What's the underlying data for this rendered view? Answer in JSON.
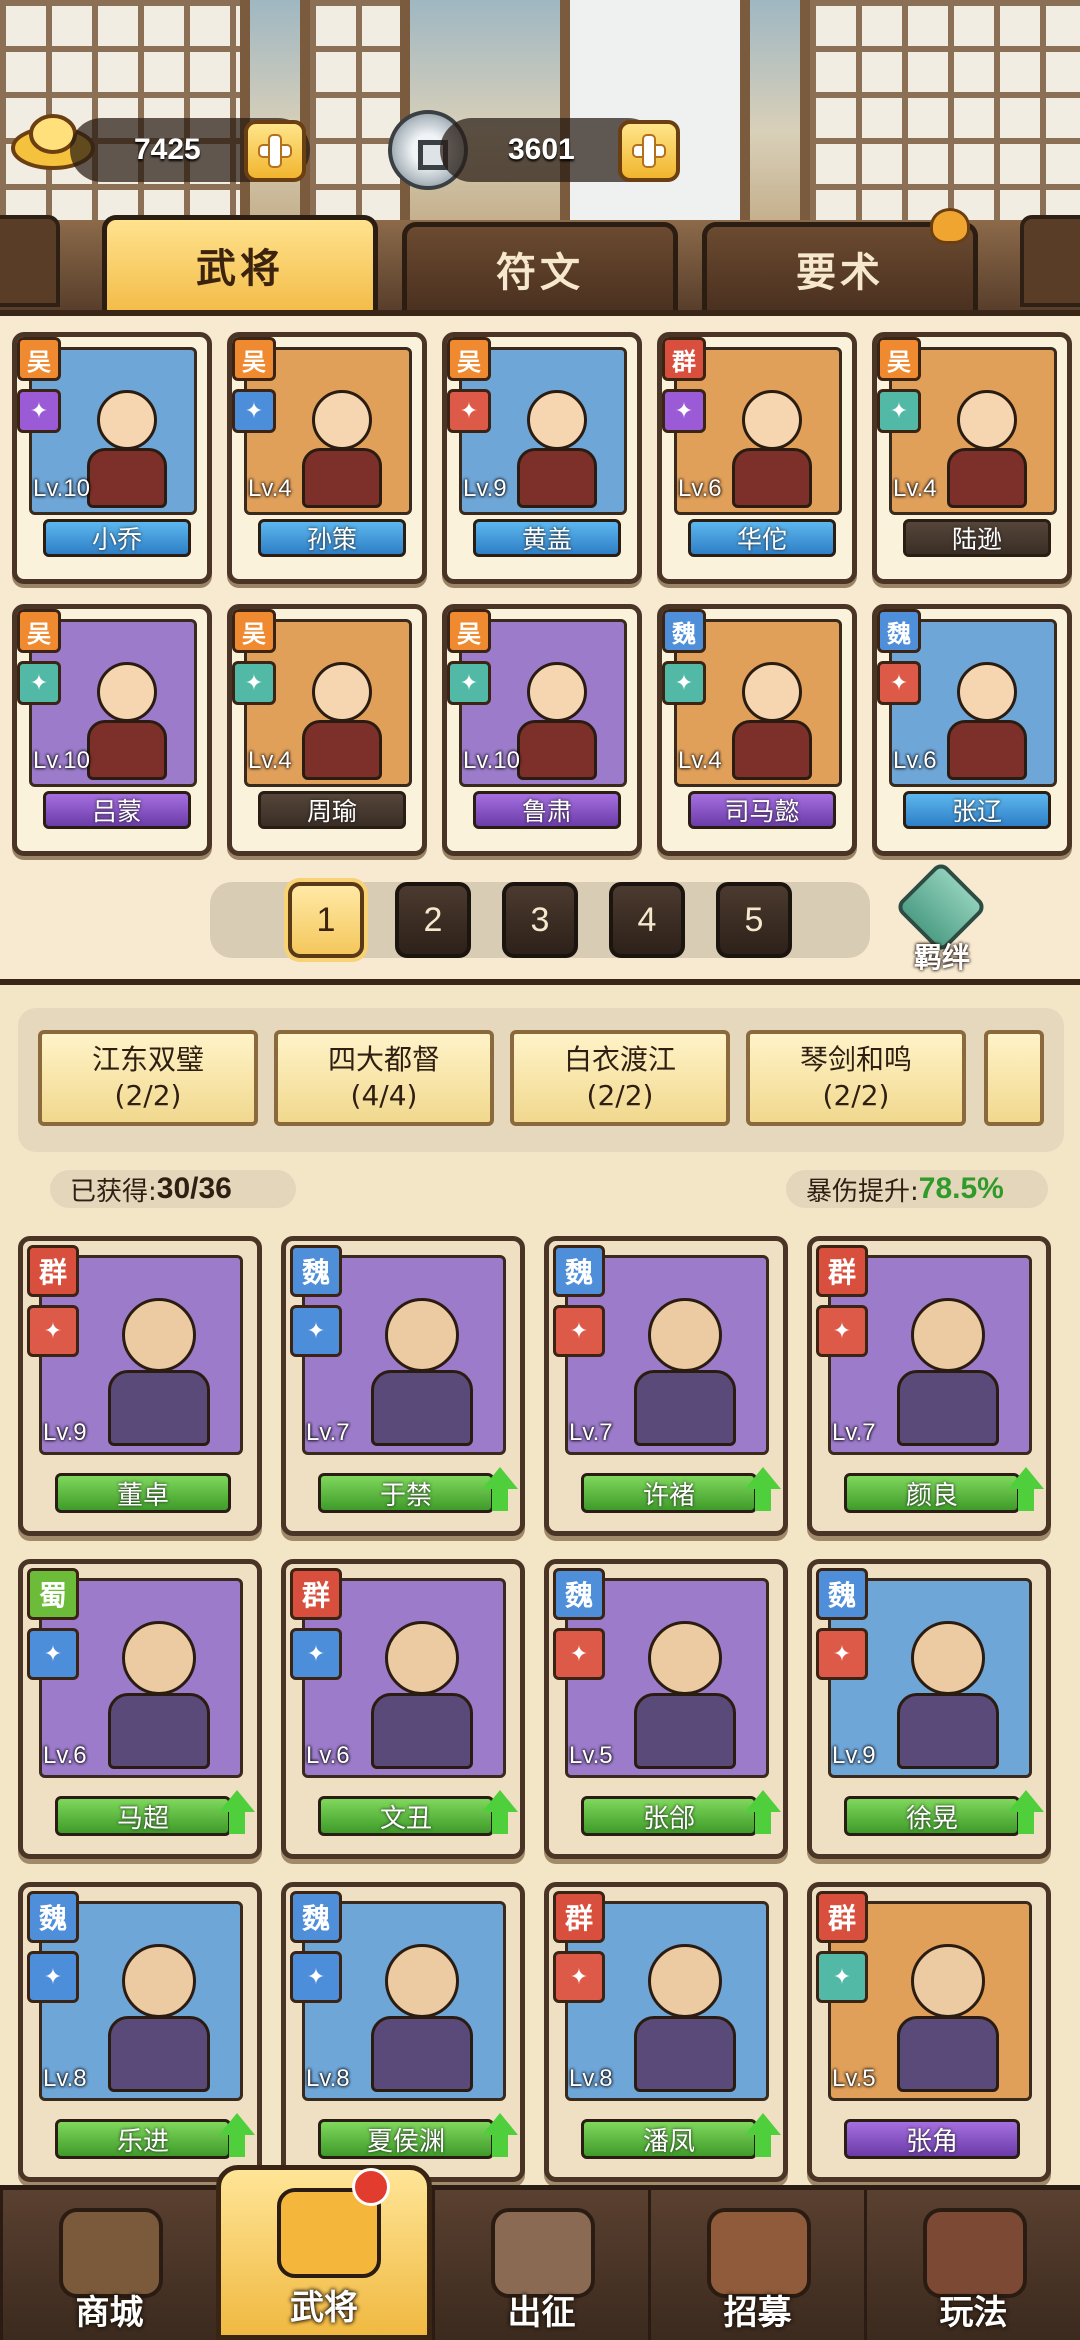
{
  "currency": {
    "gold": "7425",
    "coin": "3601"
  },
  "tabs": [
    "武将",
    "符文",
    "要术"
  ],
  "roster": [
    {
      "name": "小乔",
      "level": "Lv.10",
      "faction": "吴",
      "color": "#6fa6d8",
      "bar": "blue"
    },
    {
      "name": "孙策",
      "level": "Lv.4",
      "faction": "吴",
      "color": "#e1a05a",
      "bar": "blue"
    },
    {
      "name": "黄盖",
      "level": "Lv.9",
      "faction": "吴",
      "color": "#6fa6d8",
      "bar": "blue"
    },
    {
      "name": "华佗",
      "level": "Lv.6",
      "faction": "群",
      "color": "#e1a05a",
      "bar": "blue"
    },
    {
      "name": "陆逊",
      "level": "Lv.4",
      "faction": "吴",
      "color": "#e1a05a",
      "bar": "dark"
    },
    {
      "name": "吕蒙",
      "level": "Lv.10",
      "faction": "吴",
      "color": "#9d7bcb",
      "bar": "purple"
    },
    {
      "name": "周瑜",
      "level": "Lv.4",
      "faction": "吴",
      "color": "#e1a05a",
      "bar": "dark"
    },
    {
      "name": "鲁肃",
      "level": "Lv.10",
      "faction": "吴",
      "color": "#9d7bcb",
      "bar": "purple"
    },
    {
      "name": "司马懿",
      "level": "Lv.4",
      "faction": "魏",
      "color": "#e1a05a",
      "bar": "purple"
    },
    {
      "name": "张辽",
      "level": "Lv.6",
      "faction": "魏",
      "color": "#6fa6d8",
      "bar": "blue"
    }
  ],
  "pages": [
    "1",
    "2",
    "3",
    "4",
    "5"
  ],
  "bond_button": "羁绊",
  "bonds": [
    {
      "title": "江东双璧",
      "count": "(2/2)"
    },
    {
      "title": "四大都督",
      "count": "(4/4)"
    },
    {
      "title": "白衣渡江",
      "count": "(2/2)"
    },
    {
      "title": "琴剑和鸣",
      "count": "(2/2)"
    }
  ],
  "stats": {
    "obtained_label": "已获得:",
    "obtained_value": "30/36",
    "crit_label": "暴伤提升:",
    "crit_value": "78.5%"
  },
  "heroes": [
    {
      "name": "董卓",
      "level": "Lv.9",
      "faction": "群",
      "color": "#9d7bcb",
      "up": false
    },
    {
      "name": "于禁",
      "level": "Lv.7",
      "faction": "魏",
      "color": "#9d7bcb",
      "up": true
    },
    {
      "name": "许褚",
      "level": "Lv.7",
      "faction": "魏",
      "color": "#9d7bcb",
      "up": true
    },
    {
      "name": "颜良",
      "level": "Lv.7",
      "faction": "群",
      "color": "#9d7bcb",
      "up": true
    },
    {
      "name": "马超",
      "level": "Lv.6",
      "faction": "蜀",
      "color": "#9d7bcb",
      "up": true
    },
    {
      "name": "文丑",
      "level": "Lv.6",
      "faction": "群",
      "color": "#9d7bcb",
      "up": true
    },
    {
      "name": "张郃",
      "level": "Lv.5",
      "faction": "魏",
      "color": "#9d7bcb",
      "up": true
    },
    {
      "name": "徐晃",
      "level": "Lv.9",
      "faction": "魏",
      "color": "#6fa6d8",
      "up": true
    },
    {
      "name": "乐进",
      "level": "Lv.8",
      "faction": "魏",
      "color": "#6fa6d8",
      "up": true
    },
    {
      "name": "夏侯渊",
      "level": "Lv.8",
      "faction": "魏",
      "color": "#6fa6d8",
      "up": true
    },
    {
      "name": "潘凤",
      "level": "Lv.8",
      "faction": "群",
      "color": "#6fa6d8",
      "up": true
    },
    {
      "name": "张角",
      "level": "Lv.5",
      "faction": "群",
      "color": "#e1a05a",
      "up": false
    }
  ],
  "nav": [
    "商城",
    "武将",
    "出征",
    "招募",
    "玩法"
  ]
}
